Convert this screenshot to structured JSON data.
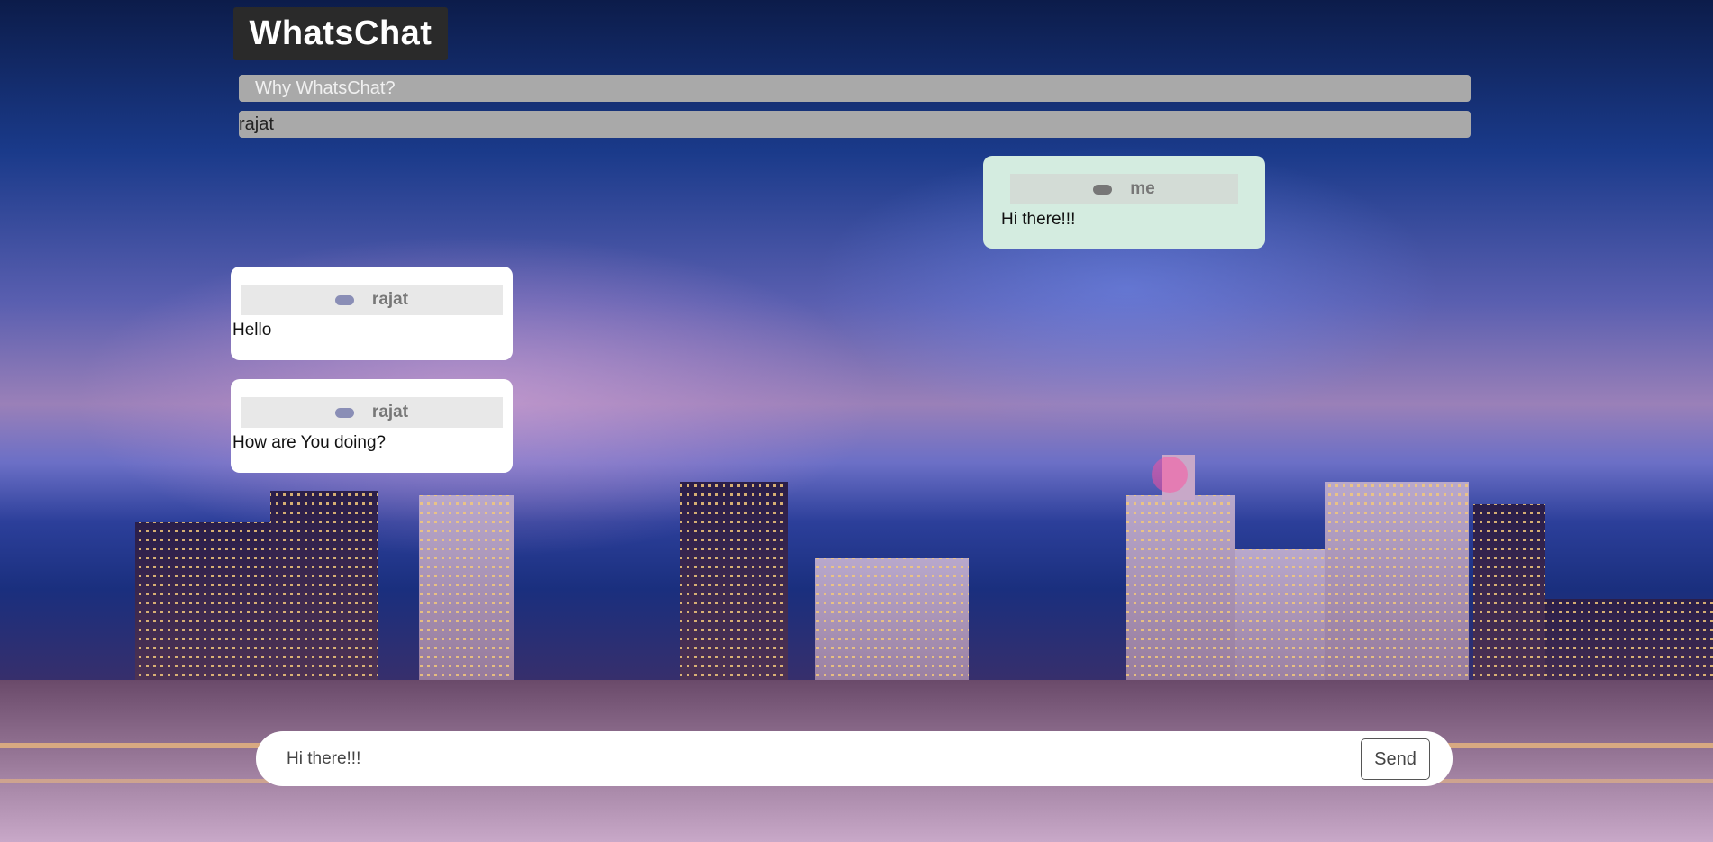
{
  "app": {
    "brand": "WhatsChat"
  },
  "nav": {
    "why_label": "Why WhatsChat?"
  },
  "user": {
    "name": "rajat"
  },
  "messages": [
    {
      "sender": "me",
      "text": "Hi there!!!",
      "mine": true
    },
    {
      "sender": "rajat",
      "text": "Hello",
      "mine": false
    },
    {
      "sender": "rajat",
      "text": "How are You doing?",
      "mine": false
    }
  ],
  "composer": {
    "value": "Hi there!!!",
    "send_label": "Send"
  },
  "colors": {
    "my_bubble": "#d4ece0",
    "their_bubble": "#ffffff",
    "brand_bg": "#2a2a2a",
    "bar_bg": "#a9a9a9"
  }
}
